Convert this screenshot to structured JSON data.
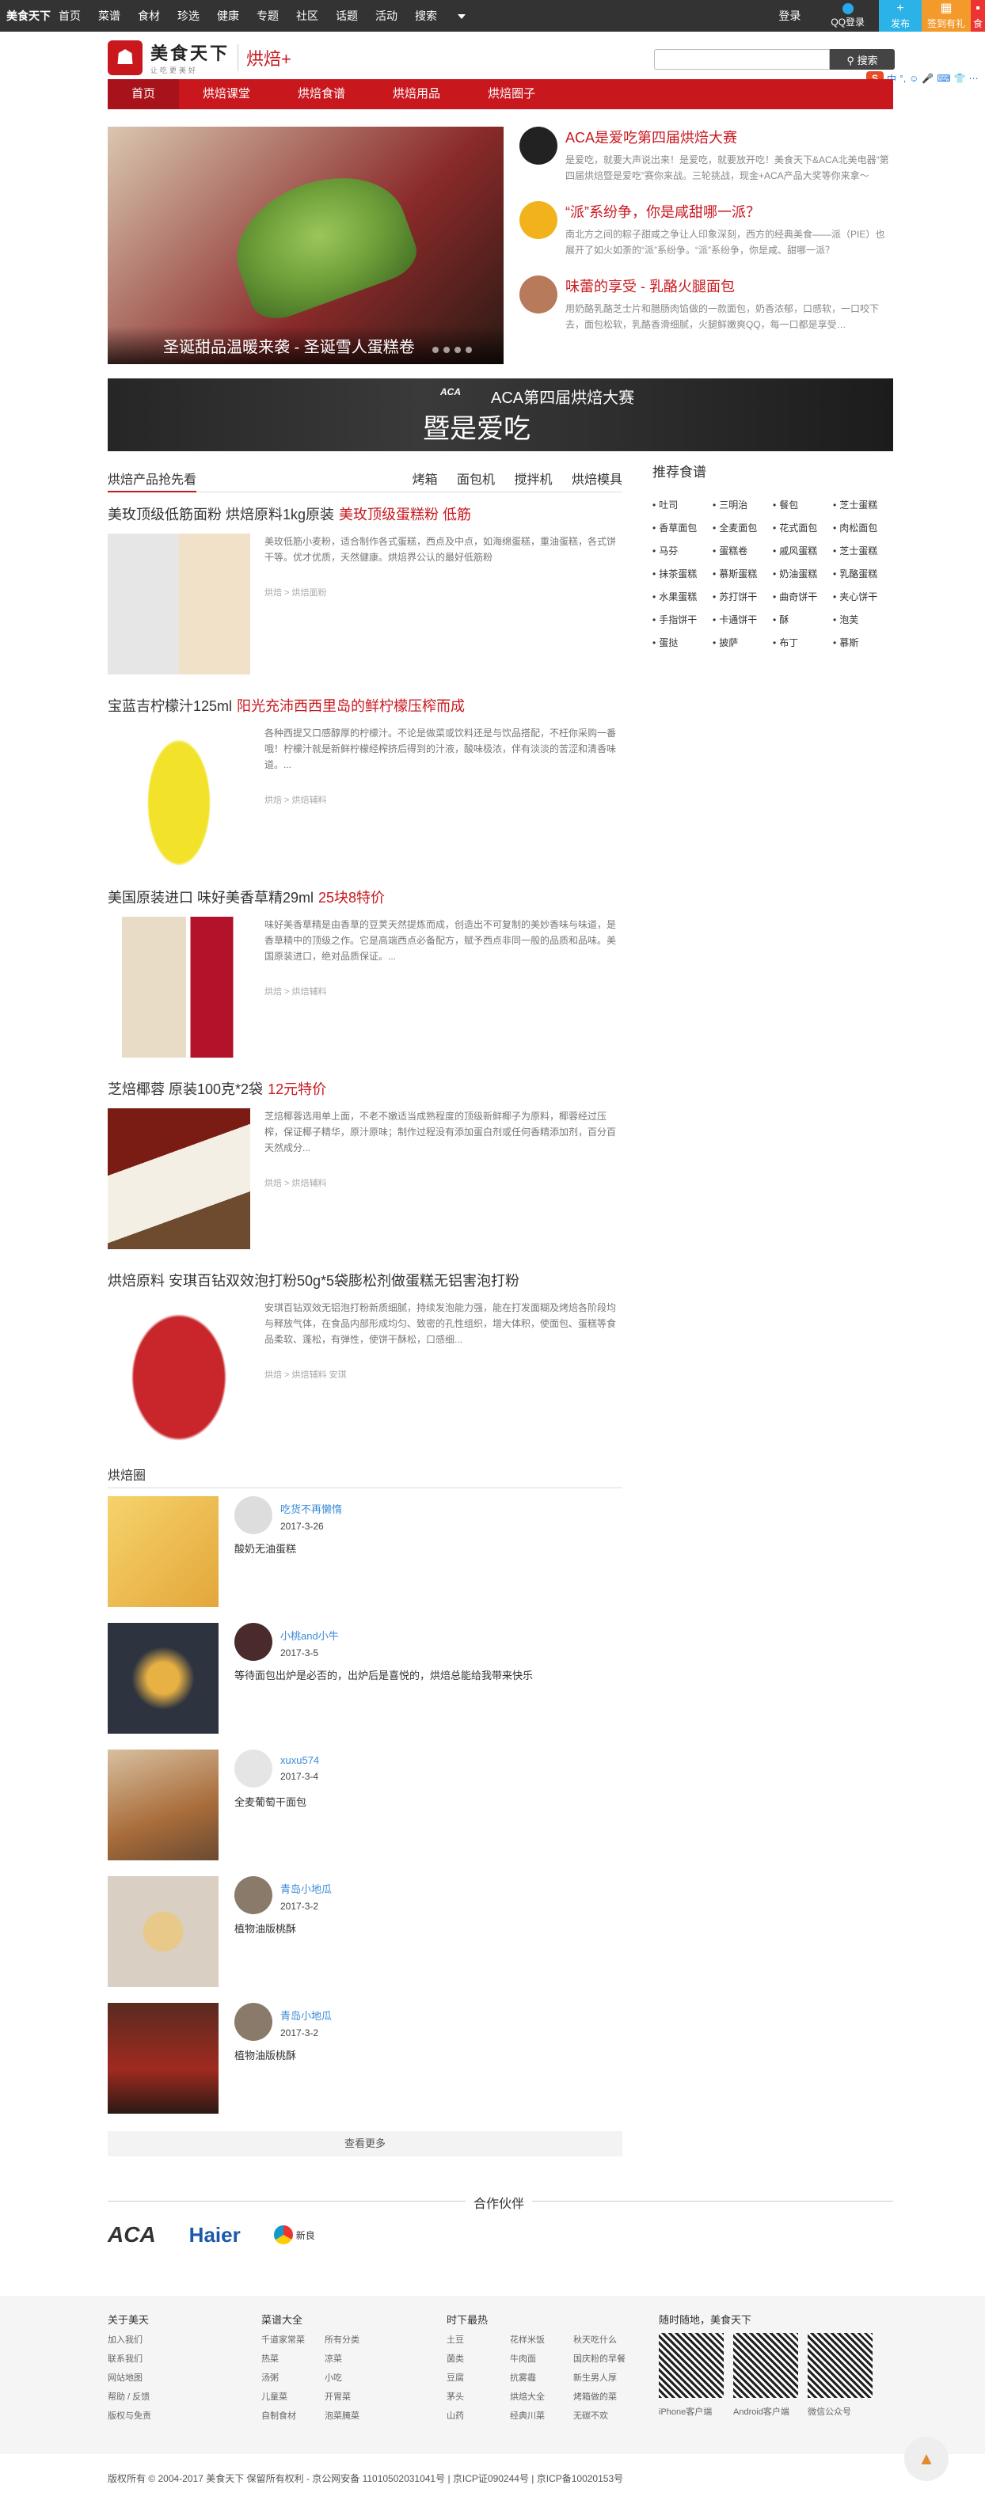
{
  "topbar": {
    "brand": "美食天下",
    "nav": [
      "首页",
      "菜谱",
      "食材",
      "珍选",
      "健康",
      "专题",
      "社区",
      "话题",
      "活动",
      "搜索"
    ],
    "login": "登录",
    "qq_login": "QQ登录",
    "publish": "发布",
    "signin": "签到有礼",
    "extra": "食"
  },
  "header": {
    "logo_name": "美食天下",
    "logo_slogan": "让吃更美好",
    "channel": "烘焙+",
    "search_placeholder": "",
    "search_button": "搜索",
    "ime_badge": "S",
    "ime_icons": [
      "中",
      "°,",
      "☺",
      "🎤",
      "⌨",
      "👕",
      "⋯"
    ]
  },
  "rednav": [
    "首页",
    "烘焙课堂",
    "烘焙食谱",
    "烘焙用品",
    "烘焙圈子"
  ],
  "hero": {
    "caption": "圣诞甜品温暖来袭 - 圣诞雪人蛋糕卷"
  },
  "news": [
    {
      "title": "ACA是爱吃第四届烘焙大赛",
      "desc": "是爱吃，就要大声说出来！是爱吃，就要放开吃！美食天下&ACA北美电器“第四届烘焙暨是爱吃”赛你来战。三轮挑战，现金+ACA产品大奖等你来拿～",
      "color": "#c9171e"
    },
    {
      "title": "“派”系纷争，你是咸甜哪一派？",
      "desc": "南北方之间的粽子甜咸之争让人印象深刻，西方的经典美食——派（PIE）也展开了如火如荼的“派”系纷争。“派”系纷争，你是咸、甜哪一派？",
      "color": "#c9171e"
    },
    {
      "title": "味蕾的享受 - 乳酪火腿面包",
      "desc": "用奶酪乳酪芝士片和腊肠肉馅做的一款面包，奶香浓郁，口感软，一口咬下去，面包松软，乳酪香滑细腻，火腿鲜嫩爽QQ，每一口都是享受…",
      "color": "#c9171e"
    }
  ],
  "banner": {
    "brand": "ACA",
    "line1": "ACA第四届烘焙大赛",
    "line2": "暨是爱吃"
  },
  "products_section": {
    "title": "烘焙产品抢先看",
    "tabs": [
      "烤箱",
      "面包机",
      "搅拌机",
      "烘焙模具"
    ]
  },
  "products": [
    {
      "title": "美玫顶级低筋面粉 烘焙原料1kg原装",
      "highlight": "美玫顶级蛋糕粉 低筋",
      "desc": "美玫低筋小麦粉，适合制作各式蛋糕，西点及中点，如海绵蛋糕，重油蛋糕，各式饼干等。优才优质，天然健康。烘焙界公认的最好低筋粉",
      "crumb": "烘焙 > 烘焙面粉"
    },
    {
      "title": "宝蓝吉柠檬汁125ml",
      "highlight": "阳光充沛西西里岛的鲜柠檬压榨而成",
      "desc": "各种西提又口感醇厚的柠檬汁。不论是做菜或饮料还是与饮品搭配，不枉你采购一番哦！柠檬汁就是新鲜柠檬经榨挤后得到的汁液，酸味极浓，伴有淡淡的苦涩和清香味道。...",
      "crumb": "烘焙 > 烘焙辅料"
    },
    {
      "title": "美国原装进口 味好美香草精29ml",
      "highlight": "25块8特价",
      "desc": "味好美香草精是由香草的豆荚天然提炼而成，创造出不可复制的美妙香味与味道，是香草精中的顶级之作。它是高端西点必备配方，赋予西点非同一般的品质和品味。美国原装进口，绝对品质保证。...",
      "crumb": "烘焙 > 烘焙辅料"
    },
    {
      "title": "芝焙椰蓉 原装100克*2袋",
      "highlight": "12元特价",
      "desc": "芝焙椰蓉选用单上面，不老不嫩适当成熟程度的顶级新鲜椰子为原料，椰蓉经过压榨，保证椰子精华，原汁原味；制作过程没有添加蛋白剂或任何香精添加剂，百分百天然成分...",
      "crumb": "烘焙 > 烘焙辅料"
    },
    {
      "title": "烘焙原料 安琪百钻双效泡打粉50g*5袋膨松剂做蛋糕无铝害泡打粉",
      "highlight": "",
      "desc": "安琪百钻双效无铝泡打粉新质细腻，持续发泡能力强，能在打发面糊及烤焙各阶段均与释放气体，在食品内部形成均匀、致密的孔性组织，增大体积，使面包、蛋糕等食品柔软、蓬松，有弹性，使饼干酥松，口感细...",
      "crumb": "烘焙 > 烘焙辅料 安琪"
    }
  ],
  "circle_section": {
    "title": "烘焙圈"
  },
  "circle": [
    {
      "user": "吃货不再懒惰",
      "date": "2017-3-26",
      "text": "酸奶无油蛋糕"
    },
    {
      "user": "小桃and小牛",
      "date": "2017-3-5",
      "text": "等待面包出炉是必否的，出炉后是喜悦的，烘焙总能给我带来快乐"
    },
    {
      "user": "xuxu574",
      "date": "2017-3-4",
      "text": "全麦葡萄干面包"
    },
    {
      "user": "青岛小地瓜",
      "date": "2017-3-2",
      "text": "植物油版桃酥"
    },
    {
      "user": "青岛小地瓜",
      "date": "2017-3-2",
      "text": "植物油版桃酥"
    }
  ],
  "more_button": "查看更多",
  "sidebar": {
    "title": "推荐食谱",
    "tags": [
      "吐司",
      "三明治",
      "餐包",
      "芝士蛋糕",
      "香草面包",
      "全麦面包",
      "花式面包",
      "肉松面包",
      "马芬",
      "蛋糕卷",
      "戚风蛋糕",
      "芝士蛋糕",
      "抹茶蛋糕",
      "慕斯蛋糕",
      "奶油蛋糕",
      "乳酪蛋糕",
      "水果蛋糕",
      "苏打饼干",
      "曲奇饼干",
      "夹心饼干",
      "手指饼干",
      "卡通饼干",
      "酥",
      "泡芙",
      "蛋挞",
      "披萨",
      "布丁",
      "慕斯"
    ]
  },
  "partners": {
    "title": "合作伙伴",
    "logos": [
      "ACA",
      "Haier",
      "新良"
    ]
  },
  "footer": {
    "about": {
      "title": "关于美天",
      "links": [
        "加入我们",
        "联系我们",
        "网站地图",
        "帮助 / 反馈",
        "版权与免责"
      ]
    },
    "recipes": {
      "title": "菜谱大全",
      "links": [
        "千道家常菜",
        "所有分类",
        "热菜",
        "凉菜",
        "汤粥",
        "小吃",
        "儿童菜",
        "开胃菜",
        "自制食材",
        "泡菜腌菜"
      ]
    },
    "hot": {
      "title": "时下最热",
      "links": [
        "土豆",
        "花样米饭",
        "秋天吃什么",
        "菌类",
        "牛肉面",
        "国庆粉的早餐",
        "豆腐",
        "抗雾霾",
        "新生男人厚",
        "茅头",
        "烘焙大全",
        "烤箱做的菜",
        "山药",
        "经典川菜",
        "无碳不欢"
      ]
    },
    "apps": {
      "title": "随时随地，美食天下",
      "labels": [
        "iPhone客户端",
        "Android客户端",
        "微信公众号"
      ]
    }
  },
  "copyright": "版权所有 © 2004-2017 美食天下 保留所有权利 - 京公网安备 11010502031041号 | 京ICP证090244号 | 京ICP备10020153号",
  "totop_icon": "rocket-icon"
}
